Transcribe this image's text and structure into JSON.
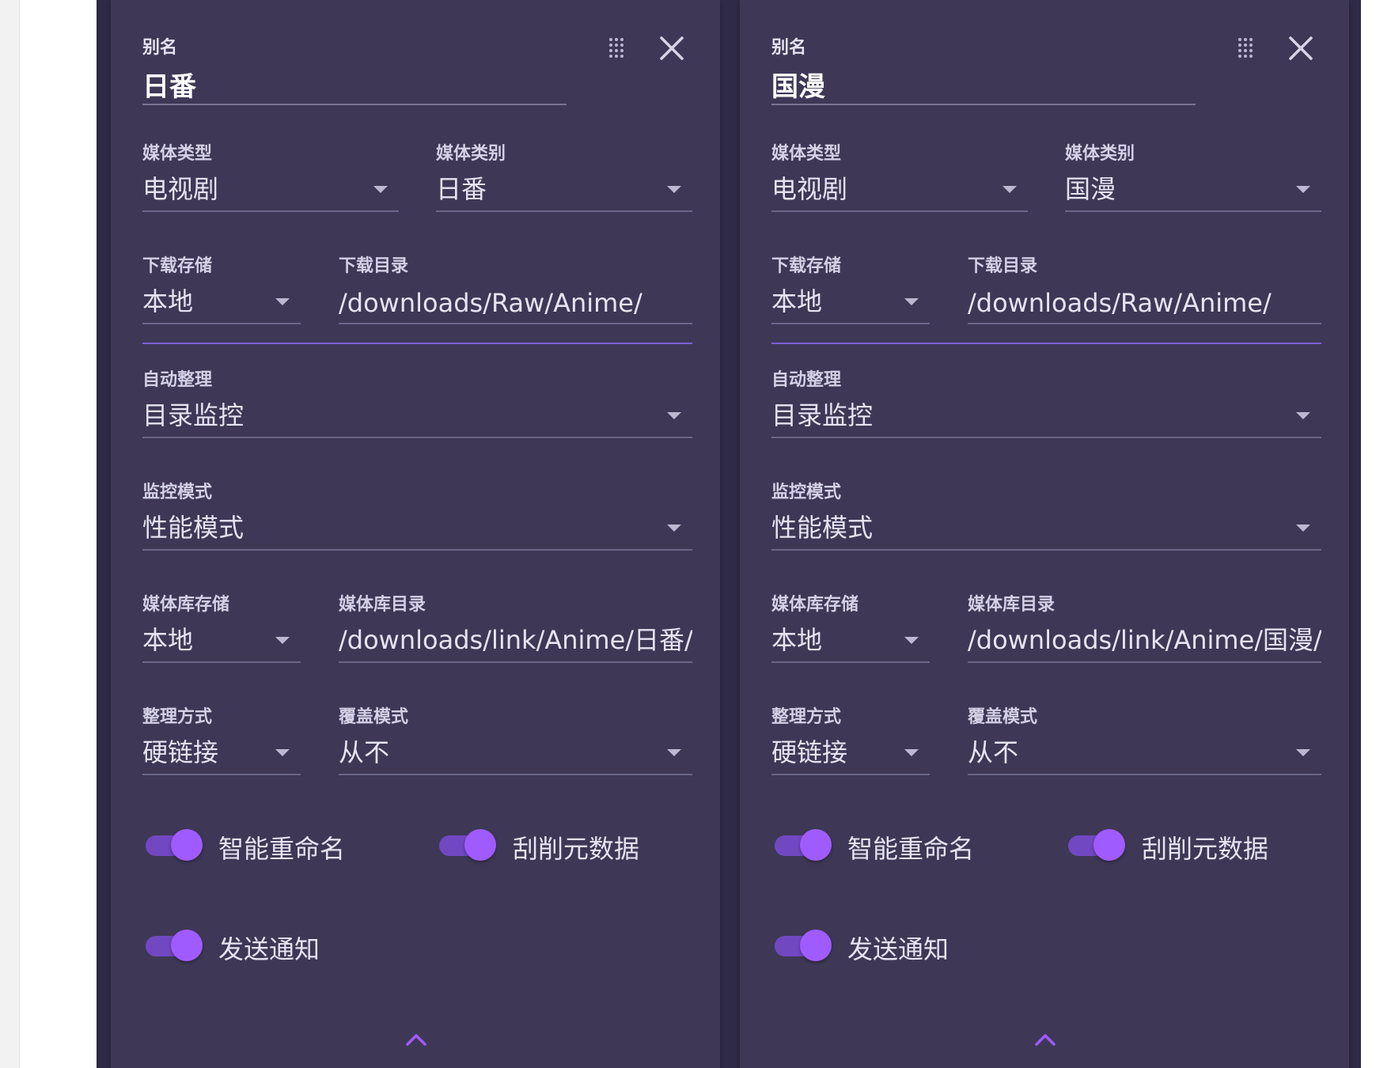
{
  "cards": [
    {
      "alias_label": "别名",
      "alias_value": "日番",
      "media_type_label": "媒体类型",
      "media_type_value": "电视剧",
      "media_category_label": "媒体类别",
      "media_category_value": "日番",
      "download_storage_label": "下载存储",
      "download_storage_value": "本地",
      "download_dir_label": "下载目录",
      "download_dir_value": "/downloads/Raw/Anime/",
      "auto_organize_label": "自动整理",
      "auto_organize_value": "目录监控",
      "monitor_mode_label": "监控模式",
      "monitor_mode_value": "性能模式",
      "library_storage_label": "媒体库存储",
      "library_storage_value": "本地",
      "library_dir_label": "媒体库目录",
      "library_dir_value": "/downloads/link/Anime/日番/",
      "organize_method_label": "整理方式",
      "organize_method_value": "硬链接",
      "overwrite_mode_label": "覆盖模式",
      "overwrite_mode_value": "从不",
      "smart_rename_label": "智能重命名",
      "smart_rename_on": true,
      "scrape_metadata_label": "刮削元数据",
      "scrape_metadata_on": true,
      "send_notification_label": "发送通知",
      "send_notification_on": true
    },
    {
      "alias_label": "别名",
      "alias_value": "国漫",
      "media_type_label": "媒体类型",
      "media_type_value": "电视剧",
      "media_category_label": "媒体类别",
      "media_category_value": "国漫",
      "download_storage_label": "下载存储",
      "download_storage_value": "本地",
      "download_dir_label": "下载目录",
      "download_dir_value": "/downloads/Raw/Anime/",
      "auto_organize_label": "自动整理",
      "auto_organize_value": "目录监控",
      "monitor_mode_label": "监控模式",
      "monitor_mode_value": "性能模式",
      "library_storage_label": "媒体库存储",
      "library_storage_value": "本地",
      "library_dir_label": "媒体库目录",
      "library_dir_value": "/downloads/link/Anime/国漫/",
      "organize_method_label": "整理方式",
      "organize_method_value": "硬链接",
      "overwrite_mode_label": "覆盖模式",
      "overwrite_mode_value": "从不",
      "smart_rename_label": "智能重命名",
      "smart_rename_on": true,
      "scrape_metadata_label": "刮削元数据",
      "scrape_metadata_on": true,
      "send_notification_label": "发送通知",
      "send_notification_on": true
    }
  ],
  "icons": {
    "drag": "drag-handle-icon",
    "close": "close-icon",
    "dropdown": "caret-down-icon",
    "collapse": "chevron-up-icon"
  },
  "colors": {
    "panel_bg": "#2f2a45",
    "card_bg": "#3e3856",
    "accent": "#a05bff"
  }
}
